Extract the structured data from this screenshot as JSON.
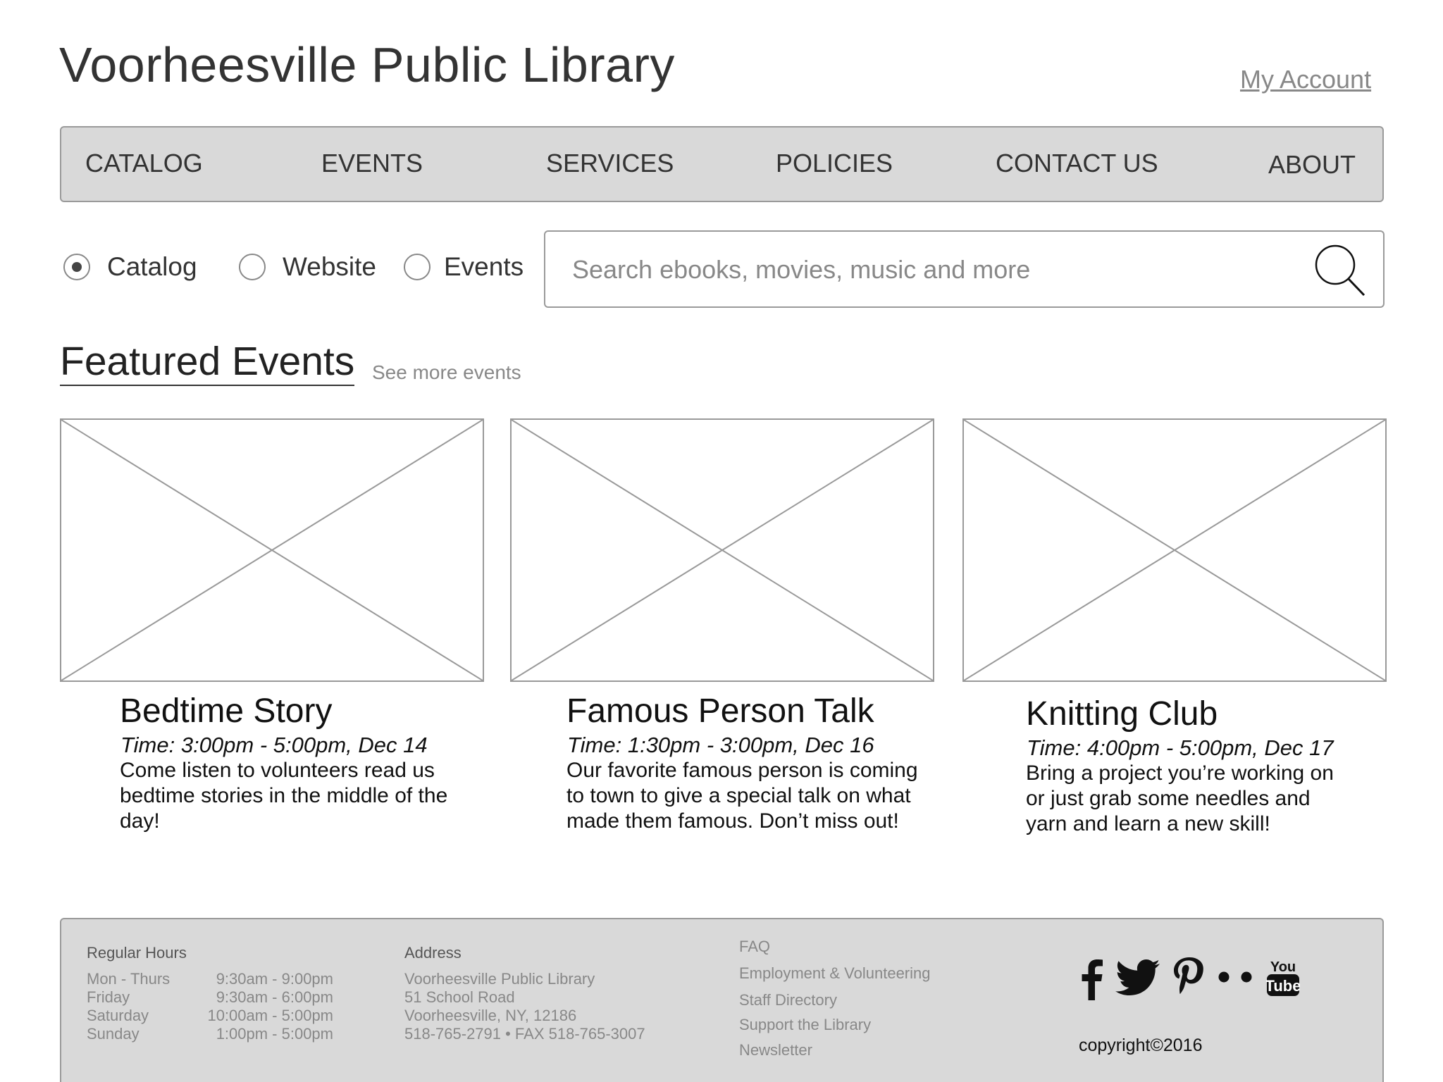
{
  "header": {
    "title": "Voorheesville Public Library",
    "my_account": "My Account"
  },
  "nav": {
    "items": [
      {
        "label": "CATALOG"
      },
      {
        "label": "EVENTS"
      },
      {
        "label": "SERVICES"
      },
      {
        "label": "POLICIES"
      },
      {
        "label": "CONTACT US"
      },
      {
        "label": "ABOUT"
      }
    ]
  },
  "search": {
    "scopes": [
      {
        "label": "Catalog",
        "selected": true
      },
      {
        "label": "Website",
        "selected": false
      },
      {
        "label": "Events",
        "selected": false
      }
    ],
    "placeholder": "Search ebooks, movies, music and more",
    "value": ""
  },
  "featured": {
    "title": "Featured Events",
    "see_more": "See more events",
    "events": [
      {
        "title": "Bedtime Story",
        "time": "Time: 3:00pm - 5:00pm, Dec 14",
        "description": "Come listen to volunteers read us bedtime stories in the middle of the day!"
      },
      {
        "title": "Famous Person Talk",
        "time": "Time: 1:30pm - 3:00pm, Dec 16",
        "description": "Our favorite famous person is coming to town to give a special talk on what made them famous. Don’t miss out!"
      },
      {
        "title": "Knitting Club",
        "time": "Time: 4:00pm - 5:00pm, Dec 17",
        "description": "Bring a project you’re working on or just grab some needles and yarn and learn a new skill!"
      }
    ]
  },
  "footer": {
    "hours": {
      "heading": "Regular Hours",
      "rows": [
        {
          "day": "Mon - Thurs",
          "time": "9:30am - 9:00pm"
        },
        {
          "day": "Friday",
          "time": "9:30am - 6:00pm"
        },
        {
          "day": "Saturday",
          "time": "10:00am - 5:00pm"
        },
        {
          "day": "Sunday",
          "time": "1:00pm - 5:00pm"
        }
      ]
    },
    "address": {
      "heading": "Address",
      "lines": [
        "Voorheesville Public Library",
        "51 School Road",
        "Voorheesville, NY, 12186",
        "518-765-2791 • FAX 518-765-3007"
      ]
    },
    "links": [
      "FAQ",
      "Employment & Volunteering",
      "Staff Directory",
      "Support the Library",
      "Newsletter"
    ],
    "social_icons": [
      "facebook-icon",
      "twitter-icon",
      "pinterest-icon",
      "flickr-icon",
      "youtube-icon"
    ],
    "youtube_text": [
      "You",
      "Tube"
    ],
    "copyright": "copyright©2016"
  }
}
